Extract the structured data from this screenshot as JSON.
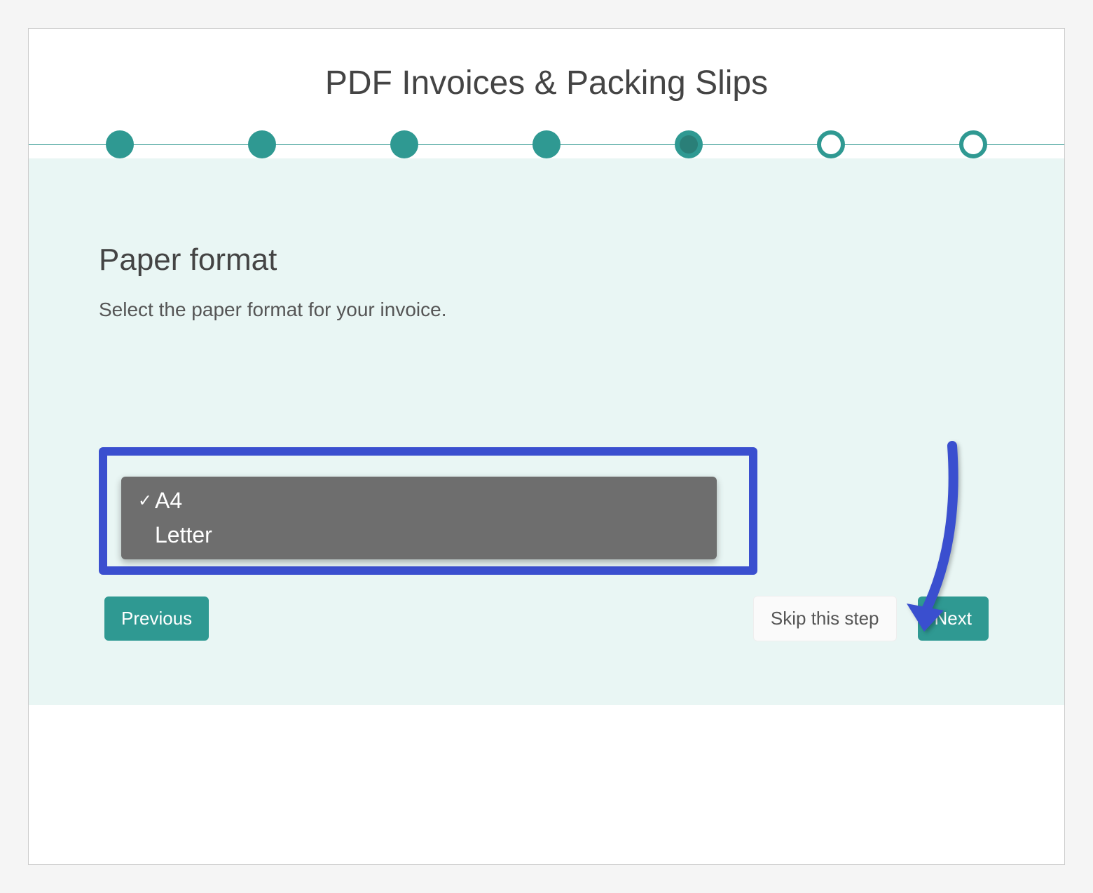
{
  "title": "PDF Invoices & Packing Slips",
  "progress": {
    "total": 7,
    "completed": 4,
    "current_index": 4
  },
  "section": {
    "heading": "Paper format",
    "subtext": "Select the paper format for your invoice."
  },
  "dropdown": {
    "options": [
      {
        "label": "A4",
        "selected": true
      },
      {
        "label": "Letter",
        "selected": false
      }
    ]
  },
  "buttons": {
    "previous": "Previous",
    "skip": "Skip this step",
    "next": "Next"
  }
}
